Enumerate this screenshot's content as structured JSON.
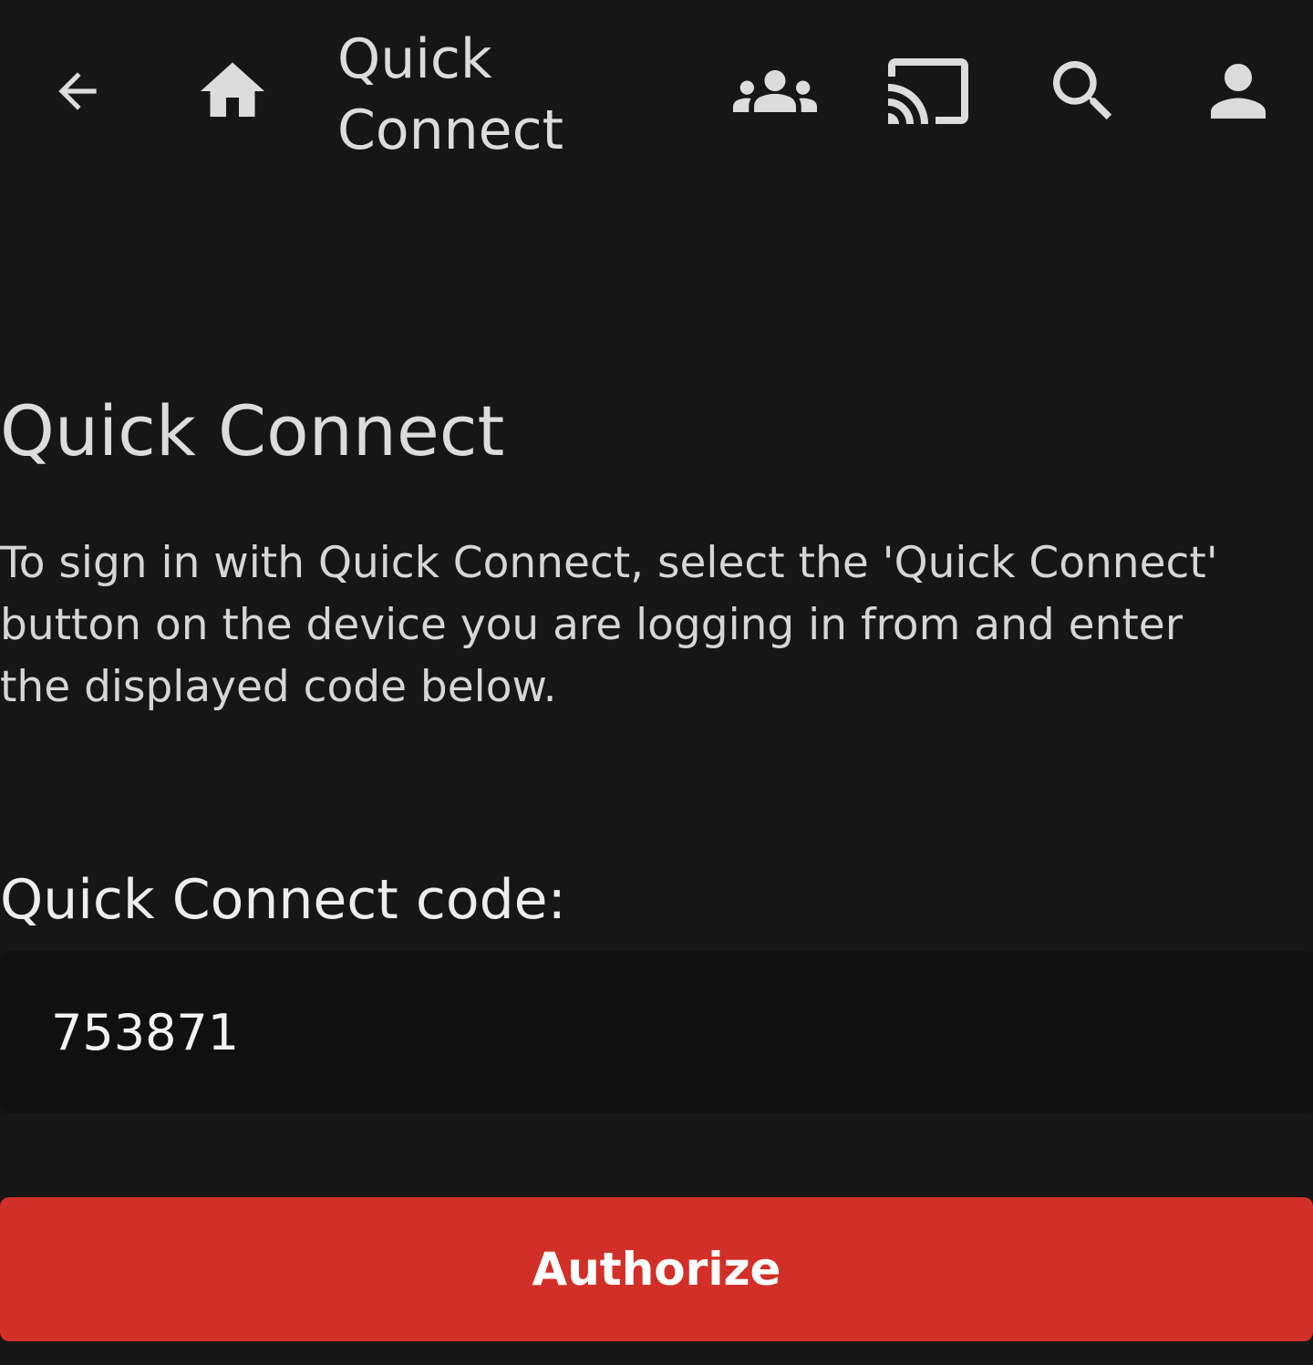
{
  "header": {
    "title": "Quick Connect",
    "icons": {
      "back": "arrow-back-icon",
      "home": "home-icon",
      "users": "group-icon",
      "cast": "cast-icon",
      "search": "search-icon",
      "profile": "person-icon"
    }
  },
  "main": {
    "title": "Quick Connect",
    "description": "To sign in with Quick Connect, select the 'Quick Connect' button on the device you are logging in from and enter the displayed code below.",
    "code_label": "Quick Connect code:",
    "code_value": "753871",
    "authorize_label": "Authorize"
  },
  "colors": {
    "background": "#161617",
    "input_background": "#101010",
    "accent": "#d22f28",
    "text": "#dcdcdc"
  }
}
